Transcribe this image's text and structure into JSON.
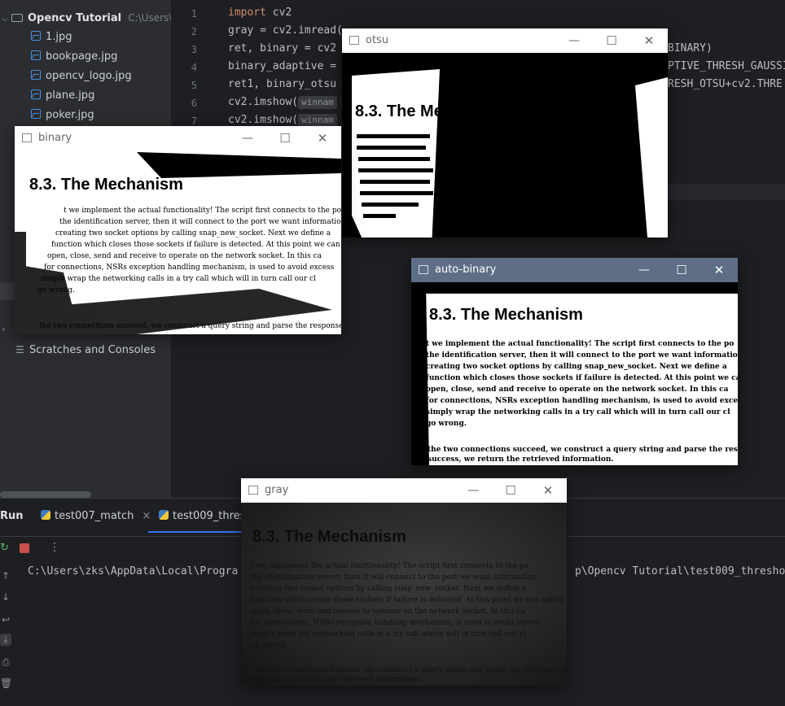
{
  "project": {
    "root_label": "Opencv Tutorial",
    "root_path": "C:\\Users\\zks",
    "files": [
      "1.jpg",
      "bookpage.jpg",
      "opencv_logo.jpg",
      "plane.jpg",
      "poker.jpg"
    ],
    "scratches_label": "Scratches and Consoles"
  },
  "editor": {
    "line_numbers": [
      "1",
      "2",
      "3",
      "4",
      "5",
      "6",
      "7"
    ],
    "lines": [
      {
        "kw": "import",
        "text": " cv2"
      },
      {
        "kw": "",
        "text": "gray = cv2.imread("
      },
      {
        "kw": "",
        "text": "ret, binary = cv2"
      },
      {
        "kw": "",
        "text": "binary_adaptive ="
      },
      {
        "kw": "",
        "text": "ret1, binary_otsu"
      },
      {
        "kw": "",
        "text": "cv2.imshow("
      },
      {
        "kw": "",
        "text": "cv2.imshow("
      }
    ],
    "hint_winname": "winnam",
    "right_fragments": [
      "BINARY)",
      "PTIVE_THRESH_GAUSSI",
      "RESH_OTSU+cv2.THRE"
    ]
  },
  "run": {
    "label": "Run",
    "tabs": [
      "test007_match",
      "test009_thresh"
    ],
    "console_path_left": "C:\\Users\\zks\\AppData\\Local\\Progra",
    "console_path_right": "p\\Opencv Tutorial\\test009_thresho"
  },
  "windows": {
    "otsu": {
      "title": "otsu"
    },
    "binary": {
      "title": "binary"
    },
    "auto_binary": {
      "title": "auto-binary"
    },
    "gray": {
      "title": "gray"
    },
    "min_glyph": "—",
    "max_glyph": "☐",
    "close_glyph": "✕"
  },
  "page_image": {
    "heading": "8.3. The Mechanism",
    "paragraph": [
      "t we implement the actual functionality! The script first connects to the po",
      "the identification server, then it will connect to the port we want information",
      "creating two socket options by calling snap_new_socket. Next we define a",
      "function which closes those sockets if failure is detected. At this point we can safely",
      "open, close, send and receive to operate on the network socket. In this ca",
      "for connections, NSRs exception handling mechanism, is used to avoid excess",
      "simply wrap the networking calls in a try call which will in turn call our cl",
      "go wrong."
    ],
    "footer_lines": [
      "the two connections succeed, we construct a query string and parse the response. If we",
      "success, we return the retrieved information."
    ]
  }
}
